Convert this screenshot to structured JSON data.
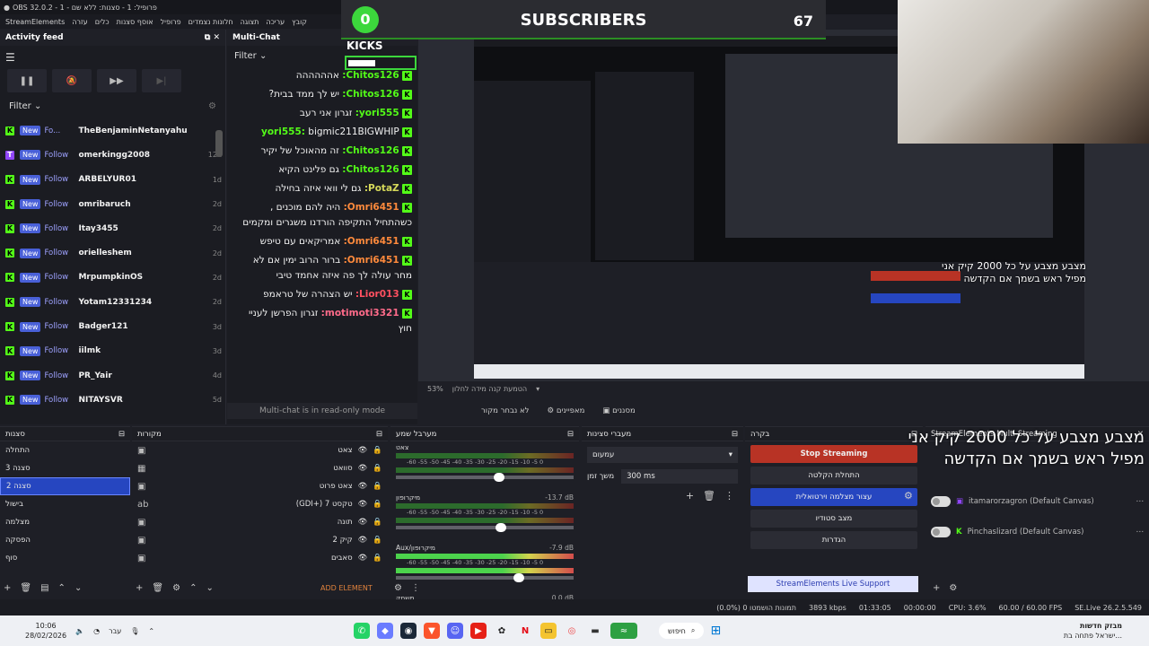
{
  "window": {
    "title": "OBS 32.0.2 - פרופיל: 1 - סצנות: ללא שם - 1"
  },
  "menu": [
    "קובץ",
    "עריכה",
    "תצוגה",
    "חלונות נצמדים",
    "פרופיל",
    "אוסף סצנות",
    "כלים",
    "עזרה",
    "StreamElements"
  ],
  "overlay": {
    "subscribers_label": "SUBSCRIBERS",
    "subscribers_count": "67",
    "progress_value": "0",
    "kicks_label": "KICKS",
    "donation_text": "מצבע מצבע על כל 2000 קיק אני מפיל ראש בשמך אם הקדשה",
    "donation_text_small": "מצבע מצבע על כל 2000 קיק אני מפיל ראש בשמך אם הקדשה"
  },
  "activity_feed": {
    "title": "Activity feed",
    "filter_label": "Filter",
    "badge": "New",
    "items": [
      {
        "platform": "kick",
        "action": "Fo...",
        "name": "TheBenjaminNetanyahu",
        "age": ""
      },
      {
        "platform": "twitch",
        "action": "Follow",
        "name": "omerkingg2008",
        "age": "12h"
      },
      {
        "platform": "kick",
        "action": "Follow",
        "name": "ARBELYUR01",
        "age": "1d"
      },
      {
        "platform": "kick",
        "action": "Follow",
        "name": "omribaruch",
        "age": "2d"
      },
      {
        "platform": "kick",
        "action": "Follow",
        "name": "Itay3455",
        "age": "2d"
      },
      {
        "platform": "kick",
        "action": "Follow",
        "name": "orielleshem",
        "age": "2d"
      },
      {
        "platform": "kick",
        "action": "Follow",
        "name": "MrpumpkinOS",
        "age": "2d"
      },
      {
        "platform": "kick",
        "action": "Follow",
        "name": "Yotam12331234",
        "age": "2d"
      },
      {
        "platform": "kick",
        "action": "Follow",
        "name": "Badger121",
        "age": "3d"
      },
      {
        "platform": "kick",
        "action": "Follow",
        "name": "iilmk",
        "age": "3d"
      },
      {
        "platform": "kick",
        "action": "Follow",
        "name": "PR_Yair",
        "age": "4d"
      },
      {
        "platform": "kick",
        "action": "Follow",
        "name": "NITAYSVR",
        "age": "5d"
      }
    ]
  },
  "multichat": {
    "title": "Multi-Chat",
    "filter_label": "Filter",
    "readonly_label": "Multi-chat is in read-only mode",
    "messages": [
      {
        "user": "Chitos126:",
        "cls": "",
        "text": "אהההההה"
      },
      {
        "user": "Chitos126:",
        "cls": "",
        "text": "יש לך ממד בבית?"
      },
      {
        "user": "yori555:",
        "cls": "",
        "text": "זגרון אני רעב"
      },
      {
        "user": "yori555:",
        "cls": "",
        "text": "bigmic211BIGWHIP"
      },
      {
        "user": "Chitos126:",
        "cls": "",
        "text": "זה מהאוכל של יקיר"
      },
      {
        "user": "Chitos126:",
        "cls": "",
        "text": "גם פלינט הקיא"
      },
      {
        "user": "PotaZ:",
        "cls": "y",
        "text": "גם לי וואי איזה בחילה"
      },
      {
        "user": "Omri6451:",
        "cls": "o",
        "text": "היה להם מוכנים , כשהתחיל התקיפה הורדנו משגרים ומקמים"
      },
      {
        "user": "Omri6451:",
        "cls": "o",
        "text": "אמריקאים עם טיפש"
      },
      {
        "user": "Omri6451:",
        "cls": "o",
        "text": "ברור הרוב ימין אם לא מחר עולה לך פה איזה אחמד טיבי"
      },
      {
        "user": "Lior013:",
        "cls": "r",
        "text": "יש הצהרה של טראמפ"
      },
      {
        "user": "motimoti3321:",
        "cls": "m",
        "text": "זגרון הפרשן לעניי חוץ"
      }
    ]
  },
  "preview": {
    "zoom": "53%",
    "scene_buttons": [
      "לא נבחר מקור",
      "מאפיינים",
      "מסננים"
    ],
    "zoom_hint": "הטמעת קנה מידה לחלון"
  },
  "scenes": {
    "title": "סצנות",
    "items": [
      "התחלה",
      "סצנה 3",
      "סצנה 2",
      "בישול",
      "מצלמה",
      "הפסקה",
      "סוף"
    ],
    "selected_index": 2
  },
  "sources": {
    "title": "מקורות",
    "items": [
      "צאט",
      "סוואט",
      "צאט פרוט",
      "(GDI+) טקסט 7",
      "תונה",
      "קיק 2",
      "סאבים"
    ],
    "add_label": "ADD ELEMENT"
  },
  "mixer": {
    "title": "מערבל שמע",
    "channels": [
      {
        "name": "צאט",
        "db": ""
      },
      {
        "name": "מיקרופון",
        "db": "-13.7 dB"
      },
      {
        "name": "Aux/מיקרופון",
        "db": "-7.9 dB"
      },
      {
        "name": "משחק",
        "db": "0.0 dB"
      }
    ],
    "ticks": "-60 -55 -50 -45 -40 -35 -30 -25 -20 -15 -10 -5 0"
  },
  "transitions": {
    "title": "מעברי סצינות",
    "type": "עמעום",
    "duration_label": "משך זמן",
    "duration": "300 ms"
  },
  "controls": {
    "title": "בקרה",
    "stop_streaming": "Stop Streaming",
    "start_recording": "התחלת הקלטה",
    "virtual_camera": "עצור מצלמה וירטואלית",
    "studio_mode": "מצב סטודיו",
    "settings": "הגדרות",
    "support": "StreamElements Live Support"
  },
  "multistream": {
    "title": "StreamElements Multi-Streaming",
    "targets": [
      {
        "platform": "twitch",
        "name": "itamarorzagron (Default Canvas)"
      },
      {
        "platform": "kick",
        "name": "Pinchaslizard (Default Canvas)"
      }
    ]
  },
  "status": {
    "dropped": "(0.0%) 0 תמונות הושמטו",
    "kbps": "3893 kbps",
    "stream_time": "01:33:05",
    "rec_time": "00:00:00",
    "cpu": "CPU: 3.6%",
    "fps": "60.00 / 60.00 FPS",
    "version": "SE.Live 26.2.5.549"
  },
  "taskbar": {
    "time": "10:06",
    "date": "28/02/2026",
    "lang": "עבר",
    "search": "חיפוש",
    "news_title": "מבזק חדשות",
    "news_sub": "ישראל פתחה בת..."
  },
  "colors": {
    "kick": "#53fc18",
    "twitch": "#9146ff",
    "accent": "#2646c0",
    "stop": "#b83325"
  }
}
